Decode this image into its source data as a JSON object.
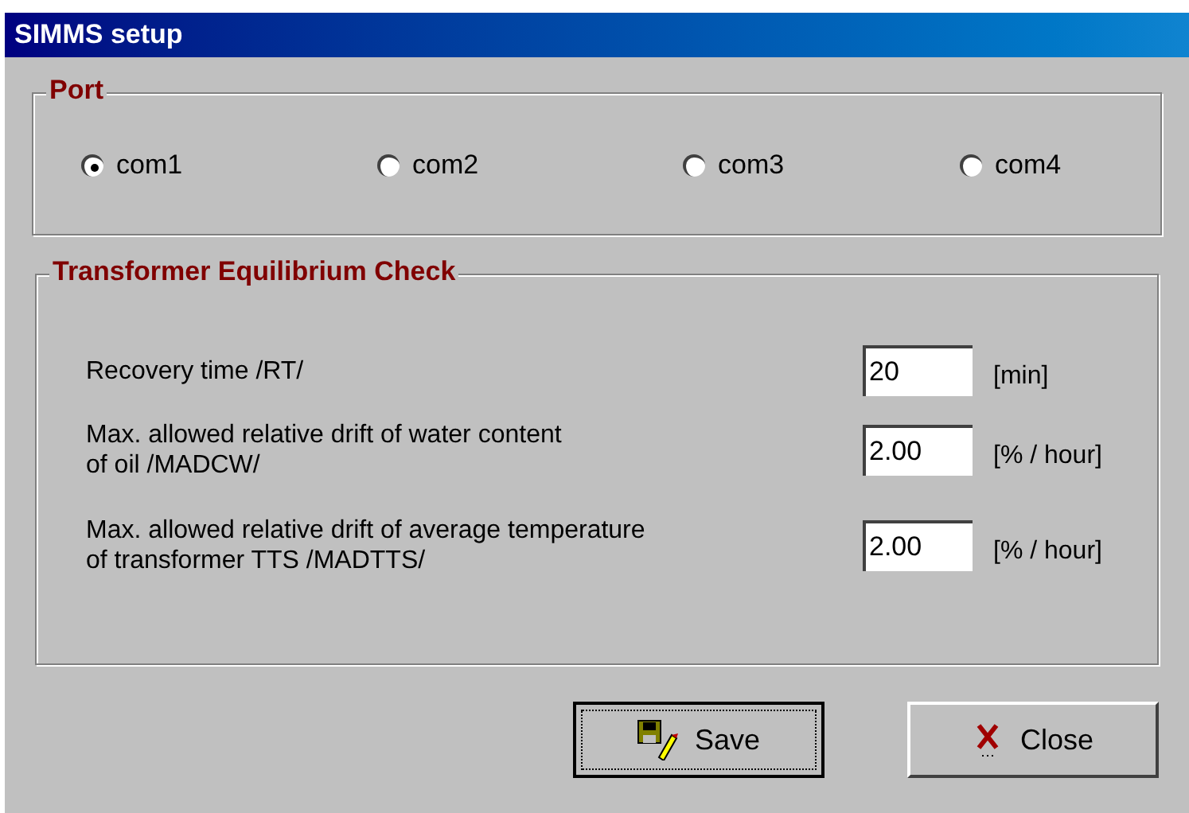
{
  "window": {
    "title": "SIMMS setup"
  },
  "port": {
    "title": "Port",
    "options": [
      {
        "label": "com1",
        "selected": true
      },
      {
        "label": "com2",
        "selected": false
      },
      {
        "label": "com3",
        "selected": false
      },
      {
        "label": "com4",
        "selected": false
      }
    ]
  },
  "equilibrium": {
    "title": "Transformer Equilibrium Check",
    "rows": [
      {
        "label": "Recovery time /RT/",
        "value": "20",
        "unit": "[min]"
      },
      {
        "label": "Max. allowed relative drift of water content\nof oil /MADCW/",
        "value": "2.00",
        "unit": "[% / hour]"
      },
      {
        "label": "Max. allowed relative drift of average temperature\nof transformer TTS /MADTTS/",
        "value": "2.00",
        "unit": "[% / hour]"
      }
    ]
  },
  "buttons": [
    {
      "kind": "save",
      "label": "Save",
      "default": true
    },
    {
      "kind": "close",
      "label": "Close",
      "default": false
    }
  ]
}
